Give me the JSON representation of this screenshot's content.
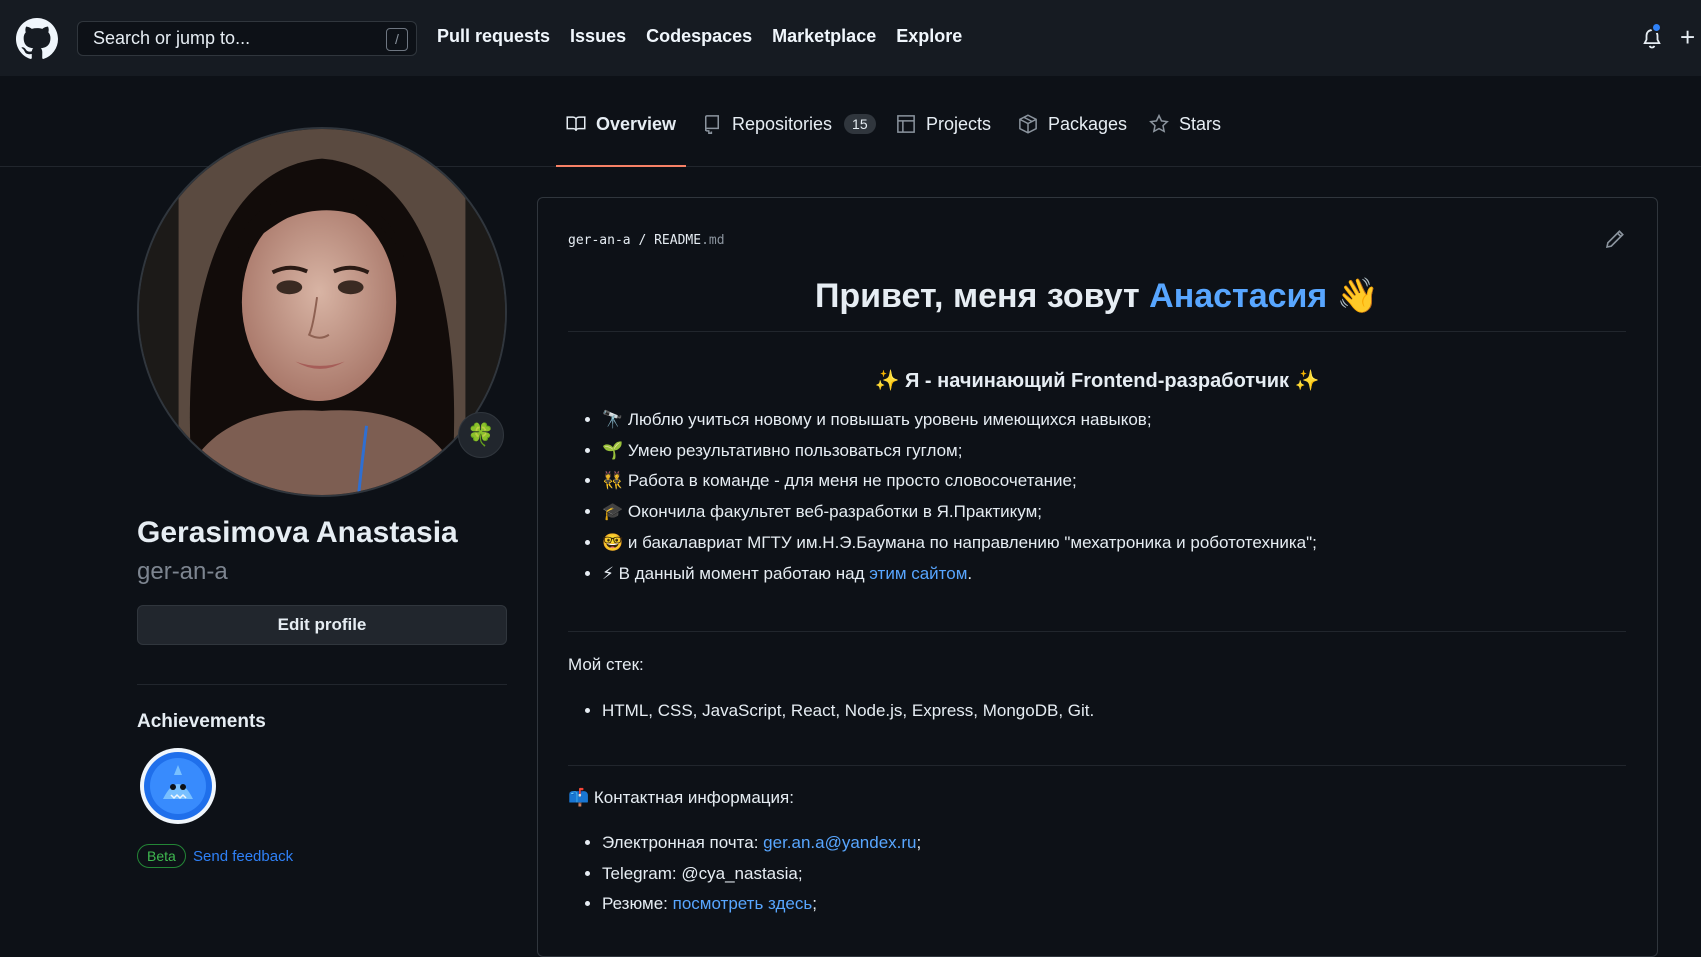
{
  "header": {
    "search_placeholder": "Search or jump to...",
    "search_shortcut": "/",
    "nav": [
      "Pull requests",
      "Issues",
      "Codespaces",
      "Marketplace",
      "Explore"
    ],
    "plus_label": "+"
  },
  "tabs": {
    "overview": "Overview",
    "repositories": "Repositories",
    "repositories_count": "15",
    "projects": "Projects",
    "packages": "Packages",
    "stars": "Stars"
  },
  "profile": {
    "full_name": "Gerasimova Anastasia",
    "login": "ger-an-a",
    "status_emoji": "🍀",
    "edit_button": "Edit profile",
    "achievements_title": "Achievements",
    "beta_label": "Beta",
    "feedback_link": "Send feedback"
  },
  "readme": {
    "path_user": "ger-an-a",
    "path_sep": "/",
    "path_file": "README",
    "path_ext": ".md",
    "title_prefix": "Привет, меня зовут ",
    "title_name": "Анастасия",
    "title_emoji": " 👋",
    "subtitle": "✨ Я - начинающий Frontend-разработчик ✨",
    "bullets": [
      "🔭 Люблю учиться новому и повышать уровень имеющихся навыков;",
      "🌱 Умею результативно пользоваться гуглом;",
      "👯 Работа в команде - для меня не просто словосочетание;",
      "🎓 Окончила факультет веб-разработки в Я.Практикум;",
      "🤓 и бакалавриат МГТУ им.Н.Э.Баумана по направлению \"мехатроника и робототехника\";"
    ],
    "last_bullet_prefix": "⚡ В данный момент работаю над ",
    "last_bullet_link": "этим сайтом",
    "last_bullet_suffix": ".",
    "stack_title": "Мой стек:",
    "stack_items": "HTML, CSS, JavaScript, React, Node.js, Express, MongoDB, Git.",
    "contacts_title": "📫 Контактная информация:",
    "email_prefix": "Электронная почта: ",
    "email_link": "ger.an.a@yandex.ru",
    "email_suffix": ";",
    "telegram": "Telegram: @cya_nastasia;",
    "resume_prefix": "Резюме: ",
    "resume_link": "посмотреть здесь",
    "resume_suffix": ";"
  },
  "colors": {
    "background": "#0d1117",
    "header_bg": "#161b22",
    "link": "#58a6ff",
    "tab_underline": "#f78166",
    "accent_green": "#3fb950"
  }
}
